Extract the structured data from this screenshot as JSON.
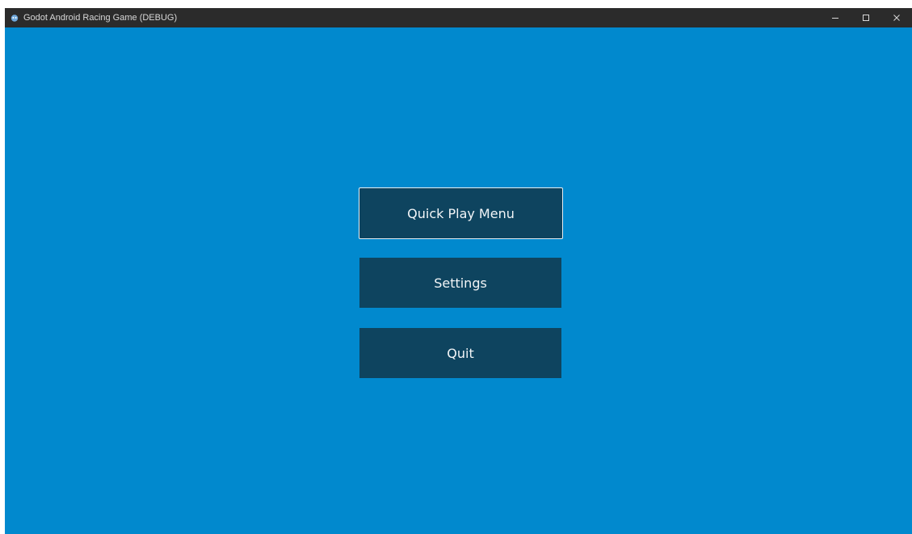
{
  "window": {
    "title": "Godot Android Racing Game (DEBUG)",
    "app_icon": "godot-icon",
    "controls": [
      "minimize-icon",
      "maximize-icon",
      "close-icon"
    ]
  },
  "theme": {
    "background": "#0189ce",
    "button_background": "#0e445f",
    "button_text": "#f2f5f7",
    "titlebar": "#2b2b2b"
  },
  "menu": {
    "quick_play_label": "Quick Play Menu",
    "settings_label": "Settings",
    "quit_label": "Quit"
  }
}
